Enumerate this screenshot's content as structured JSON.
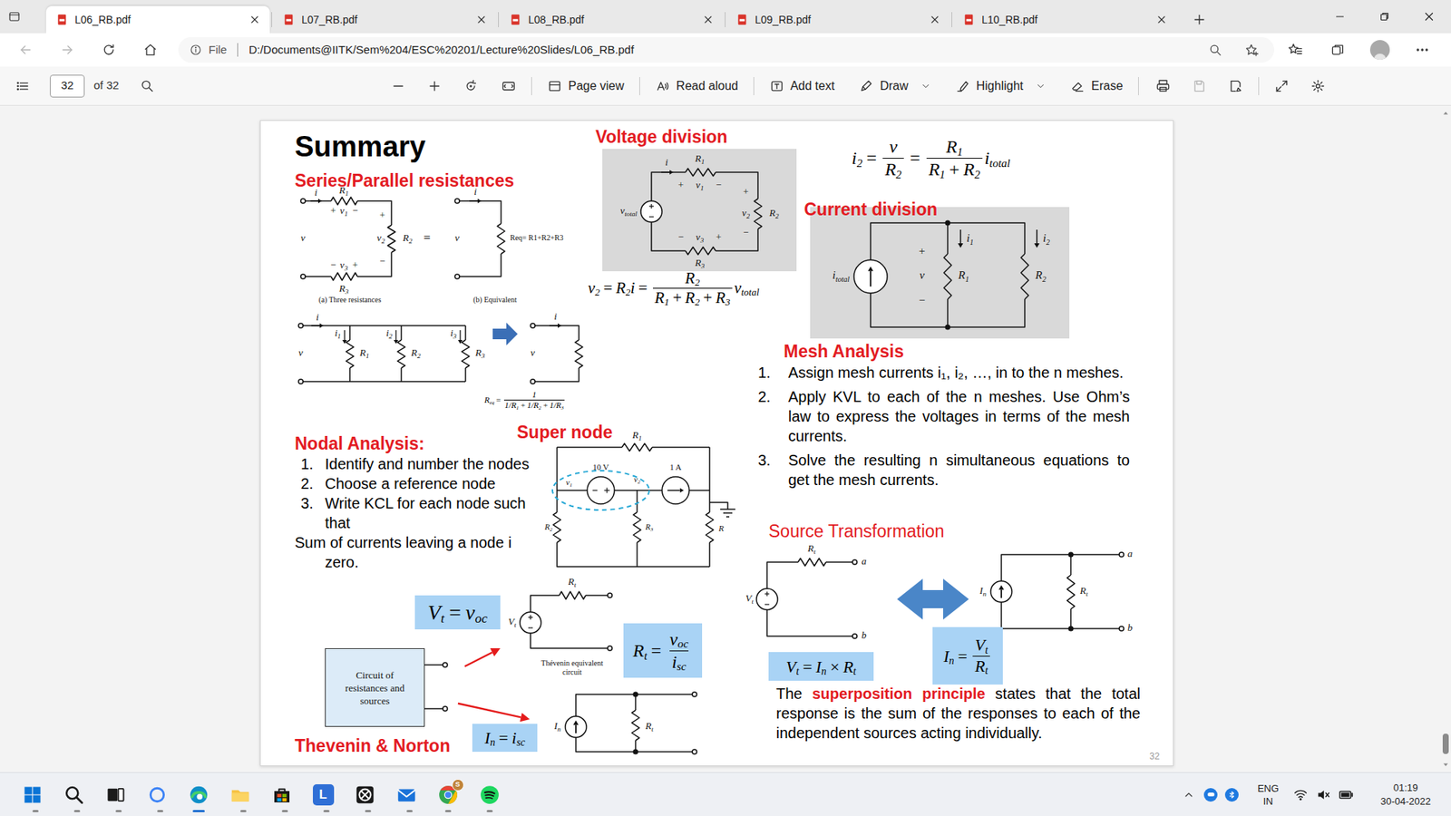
{
  "browser": {
    "tabs": [
      {
        "label": "L06_RB.pdf",
        "selected": true
      },
      {
        "label": "L07_RB.pdf",
        "selected": false
      },
      {
        "label": "L08_RB.pdf",
        "selected": false
      },
      {
        "label": "L09_RB.pdf",
        "selected": false
      },
      {
        "label": "L10_RB.pdf",
        "selected": false
      }
    ],
    "address": {
      "scheme": "File",
      "url": "D:/Documents@IITK/Sem%204/ESC%20201/Lecture%20Slides/L06_RB.pdf"
    }
  },
  "pdf_toolbar": {
    "page": "32",
    "page_count": "of 32",
    "tools": [
      {
        "label": "Page view",
        "dropdown": false
      },
      {
        "label": "Read aloud",
        "dropdown": false
      },
      {
        "label": "Add text",
        "dropdown": false
      },
      {
        "label": "Draw",
        "dropdown": true
      },
      {
        "label": "Highlight",
        "dropdown": true
      },
      {
        "label": "Erase",
        "dropdown": false
      }
    ]
  },
  "slide": {
    "title": "Summary",
    "page_number": "32",
    "series_parallel": {
      "heading": "Series/Parallel resistances",
      "series_labels": [
        {
          "text": "i"
        },
        {
          "text": "R",
          "sub": "1"
        },
        {
          "text": "+"
        },
        {
          "text": "v",
          "sub": "1"
        },
        {
          "text": "−"
        },
        {
          "text": "+"
        },
        {
          "text": "v",
          "sub": "2"
        },
        {
          "text": "−"
        },
        {
          "text": "R",
          "sub": "2"
        },
        {
          "text": "−"
        },
        {
          "text": "v",
          "sub": "3"
        },
        {
          "text": "+"
        },
        {
          "text": "R",
          "sub": "3"
        },
        {
          "text": "v"
        },
        {
          "text": "="
        },
        {
          "text": "i"
        },
        {
          "text": "v"
        },
        {
          "text": "Req= R1+R2+R3"
        },
        {
          "text": "(a) Three resistances"
        },
        {
          "text": "(b) Equivalent"
        }
      ],
      "parallel_labels": [
        {
          "text": "i"
        },
        {
          "text": "v"
        },
        {
          "text": "i",
          "sub": "1"
        },
        {
          "text": "R",
          "sub": "1"
        },
        {
          "text": "i",
          "sub": "2"
        },
        {
          "text": "R",
          "sub": "2"
        },
        {
          "text": "i",
          "sub": "3"
        },
        {
          "text": "R",
          "sub": "3"
        },
        {
          "text": "i"
        },
        {
          "text": "v"
        }
      ],
      "parallel_req": [
        {
          "kind": "sym",
          "text": "R",
          "sub": "eq"
        },
        {
          "kind": "op",
          "text": "="
        },
        {
          "kind": "frac",
          "num": [
            {
              "kind": "sym",
              "text": "1"
            }
          ],
          "den": [
            {
              "kind": "sym",
              "text": "1/R",
              "sub": "1"
            },
            {
              "kind": "op",
              "text": "+"
            },
            {
              "kind": "sym",
              "text": "1/R",
              "sub": "2"
            },
            {
              "kind": "op",
              "text": "+"
            },
            {
              "kind": "sym",
              "text": "1/R",
              "sub": "3"
            }
          ]
        }
      ]
    },
    "voltage_division": {
      "heading": "Voltage division",
      "labels": [
        {
          "text": "i"
        },
        {
          "text": "R",
          "sub": "1"
        },
        {
          "text": "+"
        },
        {
          "text": "v",
          "sub": "1"
        },
        {
          "text": "−"
        },
        {
          "text": "+"
        },
        {
          "text": "v",
          "sub": "2"
        },
        {
          "text": "−"
        },
        {
          "text": "R",
          "sub": "2"
        },
        {
          "text": "−"
        },
        {
          "text": "v",
          "sub": "3"
        },
        {
          "text": "+"
        },
        {
          "text": "R",
          "sub": "3"
        },
        {
          "text": "v",
          "sub": "total"
        }
      ],
      "formula": [
        {
          "kind": "sym",
          "text": "v",
          "sub": "2"
        },
        {
          "kind": "op",
          "text": "="
        },
        {
          "kind": "sym",
          "text": "R",
          "sub": "2"
        },
        {
          "kind": "sym",
          "text": "i"
        },
        {
          "kind": "op",
          "text": "="
        },
        {
          "kind": "frac",
          "num": [
            {
              "kind": "sym",
              "text": "R",
              "sub": "2"
            }
          ],
          "den": [
            {
              "kind": "sym",
              "text": "R",
              "sub": "1"
            },
            {
              "kind": "op",
              "text": "+"
            },
            {
              "kind": "sym",
              "text": "R",
              "sub": "2"
            },
            {
              "kind": "op",
              "text": "+"
            },
            {
              "kind": "sym",
              "text": "R",
              "sub": "3"
            }
          ]
        },
        {
          "kind": "sym",
          "text": "v",
          "sub": "total"
        }
      ]
    },
    "current_division": {
      "heading": "Current division",
      "labels": [
        {
          "text": "i",
          "sub": "total"
        },
        {
          "text": "+"
        },
        {
          "text": "v"
        },
        {
          "text": "−"
        },
        {
          "text": "i",
          "sub": "1"
        },
        {
          "text": "R",
          "sub": "1"
        },
        {
          "text": "i",
          "sub": "2"
        },
        {
          "text": "R",
          "sub": "2"
        }
      ],
      "formula": [
        {
          "kind": "sym",
          "text": "i",
          "sub": "2"
        },
        {
          "kind": "op",
          "text": "="
        },
        {
          "kind": "frac",
          "num": [
            {
              "kind": "sym",
              "text": "v"
            }
          ],
          "den": [
            {
              "kind": "sym",
              "text": "R",
              "sub": "2"
            }
          ]
        },
        {
          "kind": "op",
          "text": "="
        },
        {
          "kind": "frac",
          "num": [
            {
              "kind": "sym",
              "text": "R",
              "sub": "1"
            }
          ],
          "den": [
            {
              "kind": "sym",
              "text": "R",
              "sub": "1"
            },
            {
              "kind": "op",
              "text": "+"
            },
            {
              "kind": "sym",
              "text": "R",
              "sub": "2"
            }
          ]
        },
        {
          "kind": "sym",
          "text": "i",
          "sub": "total"
        }
      ]
    },
    "mesh": {
      "heading": "Mesh Analysis",
      "steps": [
        {
          "number": "1.",
          "text": "Assign mesh currents i₁, i₂, …, in to the n meshes."
        },
        {
          "number": "2.",
          "text": "Apply KVL to each of the n meshes. Use Ohm’s law to express the voltages in terms of the mesh currents."
        },
        {
          "number": "3.",
          "text": "Solve the resulting n simultaneous equations to get the mesh currents."
        }
      ]
    },
    "source_transformation": {
      "heading": "Source Transformation",
      "labels": [
        {
          "text": "V",
          "sub": "t"
        },
        {
          "text": "R",
          "sub": "t"
        },
        {
          "text": "a"
        },
        {
          "text": "b"
        },
        {
          "text": "I",
          "sub": "n"
        },
        {
          "text": "R",
          "sub": "t"
        },
        {
          "text": "a"
        },
        {
          "text": "b"
        }
      ],
      "formula_vt": [
        {
          "kind": "sym",
          "text": "V",
          "sub": "t"
        },
        {
          "kind": "op",
          "text": "="
        },
        {
          "kind": "sym",
          "text": "I",
          "sub": "n"
        },
        {
          "kind": "op",
          "text": "×"
        },
        {
          "kind": "sym",
          "text": "R",
          "sub": "t"
        }
      ],
      "formula_in": [
        {
          "kind": "sym",
          "text": "I",
          "sub": "n"
        },
        {
          "kind": "op",
          "text": "="
        },
        {
          "kind": "frac",
          "num": [
            {
              "kind": "sym",
              "text": "V",
              "sub": "t"
            }
          ],
          "den": [
            {
              "kind": "sym",
              "text": "R",
              "sub": "t"
            }
          ]
        }
      ]
    },
    "nodal": {
      "heading": "Nodal Analysis:",
      "steps": [
        {
          "number": "1.",
          "text": "Identify and number the nodes"
        },
        {
          "number": "2.",
          "text": "Choose a reference node"
        },
        {
          "number": "3.",
          "text": "Write KCL for each node such that"
        }
      ],
      "note": [
        "Sum of currents leaving a node i",
        "zero."
      ]
    },
    "super_node": {
      "heading": "Super node",
      "labels": [
        {
          "text": "R",
          "sub": "1"
        },
        {
          "text": "10 V"
        },
        {
          "text": "1 A"
        },
        {
          "text": "v",
          "sub": "1"
        },
        {
          "text": "v",
          "sub": "2"
        },
        {
          "text": "R",
          "sub": "2"
        },
        {
          "text": "R",
          "sub": "3"
        },
        {
          "text": "R"
        }
      ]
    },
    "thevenin": {
      "heading": "Thevenin & Norton",
      "box": "Circuit of resistances and sources",
      "labels": [
        {
          "text": "V",
          "sub": "t"
        },
        {
          "text": "R",
          "sub": "t"
        },
        {
          "text": "Thévenin equivalent"
        },
        {
          "text": "circuit"
        },
        {
          "text": "I",
          "sub": "n"
        },
        {
          "text": "R",
          "sub": "t"
        }
      ],
      "formula_vt": [
        {
          "kind": "sym",
          "text": "V",
          "sub": "t"
        },
        {
          "kind": "op",
          "text": "="
        },
        {
          "kind": "sym",
          "text": "v",
          "sub": "oc"
        }
      ],
      "formula_rt": [
        {
          "kind": "sym",
          "text": "R",
          "sub": "t"
        },
        {
          "kind": "op",
          "text": "="
        },
        {
          "kind": "frac",
          "num": [
            {
              "kind": "sym",
              "text": "v",
              "sub": "oc"
            }
          ],
          "den": [
            {
              "kind": "sym",
              "text": "i",
              "sub": "sc"
            }
          ]
        }
      ],
      "formula_in": [
        {
          "kind": "sym",
          "text": "I",
          "sub": "n"
        },
        {
          "kind": "op",
          "text": "="
        },
        {
          "kind": "sym",
          "text": "i",
          "sub": "sc"
        }
      ]
    },
    "superposition": {
      "before": "The ",
      "emphasis": "superposition principle",
      "after": " states that the total response is the sum of the responses to each of the independent sources acting individually."
    }
  },
  "taskbar": {
    "apps": [
      {
        "running": false,
        "focused": false
      },
      {
        "running": false,
        "focused": false
      },
      {
        "running": false,
        "focused": false
      },
      {
        "running": false,
        "focused": false
      },
      {
        "running": true,
        "focused": true
      },
      {
        "running": false,
        "focused": false
      },
      {
        "running": false,
        "focused": false
      },
      {
        "label": "L",
        "running": false,
        "focused": false
      },
      {
        "running": false,
        "focused": false
      },
      {
        "running": false,
        "focused": false
      },
      {
        "badge": "S",
        "running": true,
        "focused": false
      },
      {
        "running": true,
        "focused": false
      }
    ],
    "tray": {
      "language": "ENG",
      "region": "IN",
      "time": "01:19",
      "date": "30-04-2022"
    }
  }
}
